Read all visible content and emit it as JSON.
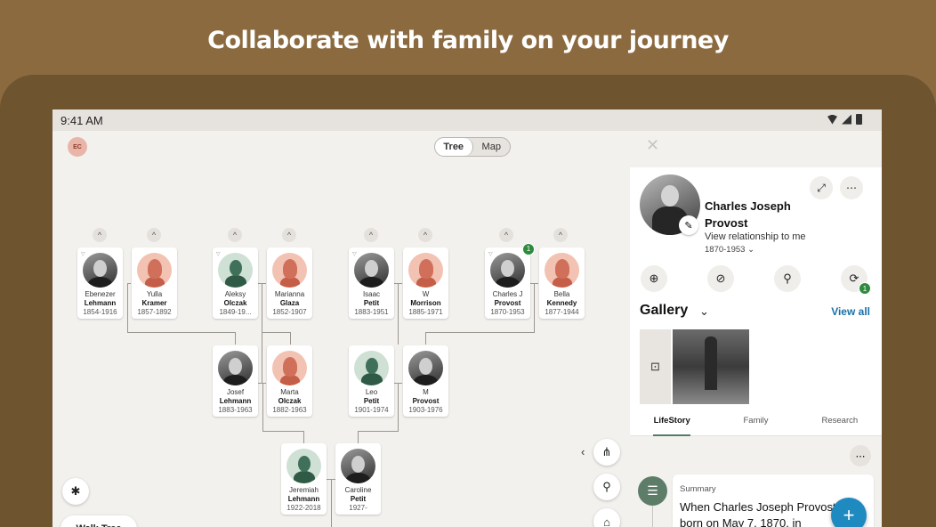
{
  "headline": "Collaborate with family on your journey",
  "status_bar": {
    "time": "9:41 AM"
  },
  "header": {
    "avatar_initials": "EC",
    "toggle": {
      "tree_label": "Tree",
      "map_label": "Map",
      "selected": "Tree"
    },
    "close_icon": "close-icon"
  },
  "tree": {
    "gen1": [
      {
        "given": "Ebenezer",
        "surname": "Lehmann",
        "years": "1854-1916",
        "avatar": "photo"
      },
      {
        "given": "Yulla",
        "surname": "Kramer",
        "years": "1857-1892",
        "avatar": "female"
      },
      {
        "given": "Aleksy",
        "surname": "Olczak",
        "years": "1849-19...",
        "avatar": "male"
      },
      {
        "given": "Marianna",
        "surname": "Glaza",
        "years": "1852-1907",
        "avatar": "female"
      },
      {
        "given": "Isaac",
        "surname": "Petit",
        "years": "1883-1951",
        "avatar": "photo"
      },
      {
        "given": "W",
        "surname": "Morrison",
        "years": "1885-1971",
        "avatar": "female"
      },
      {
        "given": "Charles J",
        "surname": "Provost",
        "years": "1870-1953",
        "avatar": "photo",
        "hint_count": "1"
      },
      {
        "given": "Bella",
        "surname": "Kennedy",
        "years": "1877-1944",
        "avatar": "female"
      }
    ],
    "gen2": [
      {
        "given": "Josef",
        "surname": "Lehmann",
        "years": "1883-1963",
        "avatar": "photo"
      },
      {
        "given": "Marta",
        "surname": "Olczak",
        "years": "1882-1963",
        "avatar": "female"
      },
      {
        "given": "Leo",
        "surname": "Petit",
        "years": "1901-1974",
        "avatar": "male"
      },
      {
        "given": "M",
        "surname": "Provost",
        "years": "1903-1976",
        "avatar": "photo"
      }
    ],
    "gen3": [
      {
        "given": "Jeremiah",
        "surname": "Lehmann",
        "years": "1922-2018",
        "avatar": "male"
      },
      {
        "given": "Caroline",
        "surname": "Petit",
        "years": "1927-",
        "avatar": "photo"
      }
    ],
    "walk_tree_label": "Walk Tree"
  },
  "profile": {
    "name": "Charles Joseph Provost",
    "relationship_link": "View relationship to me",
    "years": "1870-1953",
    "actions": [
      {
        "icon": "add-record-icon"
      },
      {
        "icon": "compass-icon"
      },
      {
        "icon": "search-icon"
      },
      {
        "icon": "hints-icon",
        "badge": "1"
      }
    ],
    "gallery": {
      "title": "Gallery",
      "view_all": "View all"
    },
    "tabs": [
      "LifeStory",
      "Family",
      "Research"
    ],
    "active_tab": "LifeStory",
    "summary": {
      "label": "Summary",
      "text": "When Charles Joseph Provost was born on May 7, 1870, in"
    }
  },
  "colors": {
    "background": "#8c6a3f",
    "accent_green": "#5d7d69",
    "link_blue": "#1a6fa8",
    "hint_green": "#2e8b3e"
  }
}
